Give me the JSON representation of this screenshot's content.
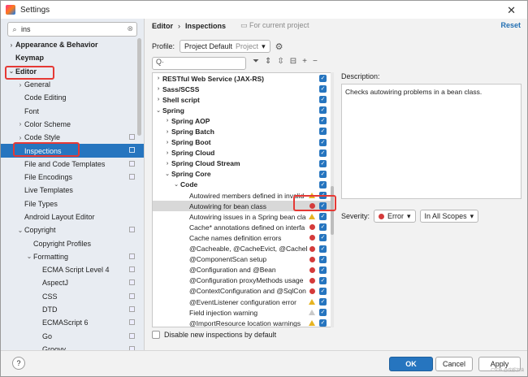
{
  "window": {
    "title": "Settings",
    "close": "✕"
  },
  "search": {
    "value": "ins"
  },
  "tree": [
    {
      "label": "Appearance & Behavior",
      "arrow": "›",
      "bold": true,
      "indent": 0,
      "copy": false,
      "selected": false
    },
    {
      "label": "Keymap",
      "arrow": "",
      "bold": true,
      "indent": 0,
      "copy": false,
      "selected": false
    },
    {
      "label": "Editor",
      "arrow": "⌄",
      "bold": true,
      "indent": 0,
      "copy": false,
      "selected": false
    },
    {
      "label": "General",
      "arrow": "›",
      "bold": false,
      "indent": 1,
      "copy": false,
      "selected": false
    },
    {
      "label": "Code Editing",
      "arrow": "",
      "bold": false,
      "indent": 1,
      "copy": false,
      "selected": false
    },
    {
      "label": "Font",
      "arrow": "",
      "bold": false,
      "indent": 1,
      "copy": false,
      "selected": false
    },
    {
      "label": "Color Scheme",
      "arrow": "›",
      "bold": false,
      "indent": 1,
      "copy": false,
      "selected": false
    },
    {
      "label": "Code Style",
      "arrow": "›",
      "bold": false,
      "indent": 1,
      "copy": true,
      "selected": false
    },
    {
      "label": "Inspections",
      "arrow": "",
      "bold": false,
      "indent": 1,
      "copy": true,
      "selected": true
    },
    {
      "label": "File and Code Templates",
      "arrow": "",
      "bold": false,
      "indent": 1,
      "copy": true,
      "selected": false
    },
    {
      "label": "File Encodings",
      "arrow": "",
      "bold": false,
      "indent": 1,
      "copy": true,
      "selected": false
    },
    {
      "label": "Live Templates",
      "arrow": "",
      "bold": false,
      "indent": 1,
      "copy": false,
      "selected": false
    },
    {
      "label": "File Types",
      "arrow": "",
      "bold": false,
      "indent": 1,
      "copy": false,
      "selected": false
    },
    {
      "label": "Android Layout Editor",
      "arrow": "",
      "bold": false,
      "indent": 1,
      "copy": false,
      "selected": false
    },
    {
      "label": "Copyright",
      "arrow": "⌄",
      "bold": false,
      "indent": 1,
      "copy": true,
      "selected": false
    },
    {
      "label": "Copyright Profiles",
      "arrow": "",
      "bold": false,
      "indent": 2,
      "copy": false,
      "selected": false
    },
    {
      "label": "Formatting",
      "arrow": "⌄",
      "bold": false,
      "indent": 2,
      "copy": true,
      "selected": false
    },
    {
      "label": "ECMA Script Level 4",
      "arrow": "",
      "bold": false,
      "indent": 3,
      "copy": true,
      "selected": false
    },
    {
      "label": "AspectJ",
      "arrow": "",
      "bold": false,
      "indent": 3,
      "copy": true,
      "selected": false
    },
    {
      "label": "CSS",
      "arrow": "",
      "bold": false,
      "indent": 3,
      "copy": true,
      "selected": false
    },
    {
      "label": "DTD",
      "arrow": "",
      "bold": false,
      "indent": 3,
      "copy": true,
      "selected": false
    },
    {
      "label": "ECMAScript 6",
      "arrow": "",
      "bold": false,
      "indent": 3,
      "copy": true,
      "selected": false
    },
    {
      "label": "Go",
      "arrow": "",
      "bold": false,
      "indent": 3,
      "copy": true,
      "selected": false
    },
    {
      "label": "Groovy",
      "arrow": "",
      "bold": false,
      "indent": 3,
      "copy": true,
      "selected": false
    }
  ],
  "breadcrumb": {
    "part1": "Editor",
    "sep": "›",
    "part2": "Inspections",
    "note": "For current project"
  },
  "reset_label": "Reset",
  "profile": {
    "label": "Profile:",
    "value": "Project Default",
    "scope": "Project"
  },
  "filter": {
    "placeholder": "Q·"
  },
  "inspections": [
    {
      "label": "RESTful Web Service (JAX-RS)",
      "arrow": "›",
      "bold": true,
      "indent": 0,
      "sev": "",
      "selected": false
    },
    {
      "label": "Sass/SCSS",
      "arrow": "›",
      "bold": true,
      "indent": 0,
      "sev": "",
      "selected": false
    },
    {
      "label": "Shell script",
      "arrow": "›",
      "bold": true,
      "indent": 0,
      "sev": "",
      "selected": false
    },
    {
      "label": "Spring",
      "arrow": "⌄",
      "bold": true,
      "indent": 0,
      "sev": "",
      "selected": false
    },
    {
      "label": "Spring AOP",
      "arrow": "›",
      "bold": true,
      "indent": 1,
      "sev": "",
      "selected": false
    },
    {
      "label": "Spring Batch",
      "arrow": "›",
      "bold": true,
      "indent": 1,
      "sev": "",
      "selected": false
    },
    {
      "label": "Spring Boot",
      "arrow": "›",
      "bold": true,
      "indent": 1,
      "sev": "",
      "selected": false
    },
    {
      "label": "Spring Cloud",
      "arrow": "›",
      "bold": true,
      "indent": 1,
      "sev": "",
      "selected": false
    },
    {
      "label": "Spring Cloud Stream",
      "arrow": "›",
      "bold": true,
      "indent": 1,
      "sev": "",
      "selected": false
    },
    {
      "label": "Spring Core",
      "arrow": "⌄",
      "bold": true,
      "indent": 1,
      "sev": "",
      "selected": false
    },
    {
      "label": "Code",
      "arrow": "⌄",
      "bold": true,
      "indent": 2,
      "sev": "",
      "selected": false
    },
    {
      "label": "Autowired members defined in invalid",
      "arrow": "",
      "bold": false,
      "indent": 3,
      "sev": "warn",
      "selected": false
    },
    {
      "label": "Autowiring for bean class",
      "arrow": "",
      "bold": false,
      "indent": 3,
      "sev": "err",
      "selected": true
    },
    {
      "label": "Autowiring issues in a Spring bean cla",
      "arrow": "",
      "bold": false,
      "indent": 3,
      "sev": "warn",
      "selected": false
    },
    {
      "label": "Cache* annotations defined on interfa",
      "arrow": "",
      "bold": false,
      "indent": 3,
      "sev": "err",
      "selected": false
    },
    {
      "label": "Cache names definition errors",
      "arrow": "",
      "bold": false,
      "indent": 3,
      "sev": "err",
      "selected": false
    },
    {
      "label": "@Cacheable, @CacheEvict, @CachePu",
      "arrow": "",
      "bold": false,
      "indent": 3,
      "sev": "err",
      "selected": false
    },
    {
      "label": "@ComponentScan setup",
      "arrow": "",
      "bold": false,
      "indent": 3,
      "sev": "err",
      "selected": false
    },
    {
      "label": "@Configuration and @Bean",
      "arrow": "",
      "bold": false,
      "indent": 3,
      "sev": "err",
      "selected": false
    },
    {
      "label": "@Configuration proxyMethods usage",
      "arrow": "",
      "bold": false,
      "indent": 3,
      "sev": "err",
      "selected": false
    },
    {
      "label": "@ContextConfiguration and @SqlCon",
      "arrow": "",
      "bold": false,
      "indent": 3,
      "sev": "err",
      "selected": false
    },
    {
      "label": "@EventListener configuration error",
      "arrow": "",
      "bold": false,
      "indent": 3,
      "sev": "warn",
      "selected": false
    },
    {
      "label": "Field injection warning",
      "arrow": "",
      "bold": false,
      "indent": 3,
      "sev": "weak",
      "selected": false
    },
    {
      "label": "@ImportResource location warnings",
      "arrow": "",
      "bold": false,
      "indent": 3,
      "sev": "warn",
      "selected": false
    }
  ],
  "description": {
    "label": "Description:",
    "text": "Checks autowiring problems in a bean class."
  },
  "severity": {
    "label": "Severity:",
    "value": "Error",
    "scope": "In All Scopes"
  },
  "disable_new": "Disable new inspections by default",
  "footer": {
    "help": "?",
    "ok": "OK",
    "cancel": "Cancel",
    "apply": "Apply"
  },
  "watermark": "CSDN @成都加油",
  "colors": {
    "accent": "#2675bf",
    "highlight": "#e53935",
    "error": "#d43b3b",
    "warning": "#e6b422"
  }
}
